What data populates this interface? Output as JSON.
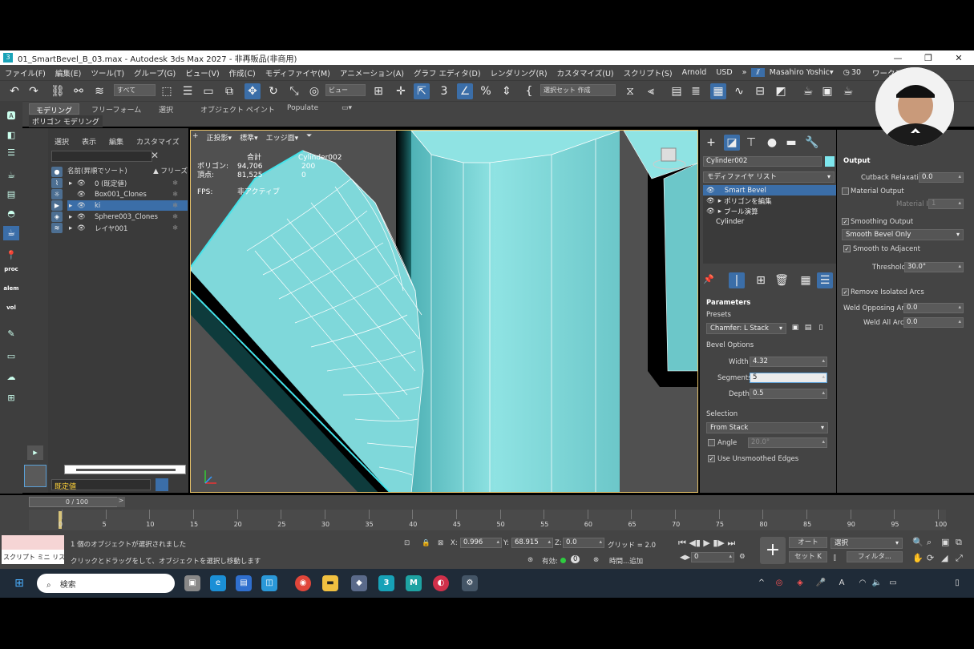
{
  "window": {
    "title": "01_SmartBevel_B_03.max - Autodesk 3ds Max 2027 - 非再販品(非商用)",
    "minimize": "—",
    "maximize": "❐",
    "close": "✕"
  },
  "menu": {
    "items": [
      "ファイル(F)",
      "編集(E)",
      "ツール(T)",
      "グループ(G)",
      "ビュー(V)",
      "作成(C)",
      "モディファイヤ(M)",
      "アニメーション(A)",
      "グラフ エディタ(D)",
      "レンダリング(R)",
      "カスタマイズ(U)",
      "スクリプト(S)",
      "Arnold",
      "USD"
    ],
    "more": "»",
    "user": "Masahiro Yoshic▾",
    "clock_count": "30",
    "workspace": "ワークスペース:"
  },
  "toolbar": {
    "filter_dd": "すべて",
    "view_dd": "ビュー",
    "selset_dd": "選択セット 作成",
    "snap_label": "3"
  },
  "ribbon": {
    "tabs": [
      "モデリング",
      "フリーフォーム",
      "選択",
      "オブジェクト ペイント",
      "Populate"
    ],
    "sub": "ポリゴン モデリング"
  },
  "left_tools": {
    "labels": [
      "proc",
      "alem",
      "vol"
    ]
  },
  "explorer": {
    "header": [
      "選択",
      "表示",
      "編集",
      "カスタマイズ"
    ],
    "col_name": "名前(昇順でソート)",
    "col_freeze": "▲ フリーズ",
    "rows": [
      {
        "name": "0 (既定値)",
        "selected": false
      },
      {
        "name": "Box001_Clones",
        "selected": false
      },
      {
        "name": "ki",
        "selected": true
      },
      {
        "name": "Sphere003_Clones",
        "selected": false
      },
      {
        "name": "レイヤ001",
        "selected": false
      }
    ],
    "layer_dd": "既定値"
  },
  "viewport": {
    "labels": [
      "+",
      "正投影▾",
      "標準▾",
      "エッジ面▾"
    ],
    "stats": {
      "total_label": "合計",
      "object_name": "Cylinder002",
      "poly_label": "ポリゴン:",
      "poly_total": "94,706",
      "poly_obj": "200",
      "vert_label": "頂点:",
      "vert_total": "81,525",
      "vert_obj": "0",
      "fps_label": "FPS:",
      "fps_value": "非アクティブ"
    }
  },
  "command_panel": {
    "object_name": "Cylinder002",
    "color": "#7ee7ee",
    "modifier_list": "モディファイヤ リスト",
    "stack": [
      "Smart Bevel",
      "ポリゴンを編集",
      "ブール演算",
      "Cylinder"
    ],
    "parameters_title": "Parameters",
    "presets_label": "Presets",
    "preset_value": "Chamfer: L Stack",
    "bevel_options": "Bevel Options",
    "width_label": "Width",
    "width_value": "4.32",
    "segments_label": "Segments",
    "segments_value": "5",
    "depth_label": "Depth",
    "depth_value": "0.5",
    "selection_label": "Selection",
    "selection_value": "From Stack",
    "angle_label": "Angle",
    "angle_value": "20.0°",
    "unsmoothed_label": "Use Unsmoothed Edges"
  },
  "output": {
    "title": "Output",
    "cutback_label": "Cutback Relaxation",
    "cutback_value": "0.0",
    "material_output": "Material Output",
    "material_id_label": "Material ID",
    "material_id_value": "1",
    "smoothing_output": "Smoothing Output",
    "smooth_dd": "Smooth Bevel Only",
    "smooth_adjacent": "Smooth to Adjacent",
    "threshold_label": "Threshold",
    "threshold_value": "30.0°",
    "remove_arcs": "Remove Isolated Arcs",
    "weld_opposing_label": "Weld Opposing Arcs",
    "weld_opposing_value": "0.0",
    "weld_all_label": "Weld All Arcs",
    "weld_all_value": "0.0"
  },
  "timeline": {
    "slider": "0 / 100",
    "ticks": [
      "0",
      "5",
      "10",
      "15",
      "20",
      "25",
      "30",
      "35",
      "40",
      "45",
      "50",
      "55",
      "60",
      "65",
      "70",
      "75",
      "80",
      "85",
      "90",
      "95",
      "100"
    ]
  },
  "status": {
    "script_tabs": "スクリプト ミニ リス:",
    "msg1": "1 個のオブジェクトが選択されました",
    "msg2": "クリックとドラッグをして、オブジェクトを選択し移動します",
    "x_label": "X:",
    "x_value": "0.996",
    "y_label": "Y:",
    "y_value": "68.915",
    "z_label": "Z:",
    "z_value": "0.0",
    "grid": "グリッド = 2.0",
    "enabled_label": "有効:",
    "enabled_value": "0",
    "time_add": "時間...追加",
    "frame_value": "0",
    "auto": "オート",
    "set_key": "セット K",
    "select_dd": "選択",
    "filter": "フィルタ..."
  },
  "taskbar": {
    "search": "検索",
    "apps": [
      "3",
      "M"
    ]
  }
}
